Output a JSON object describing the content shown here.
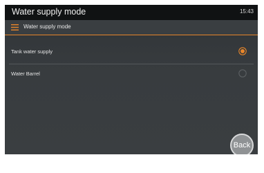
{
  "titlebar": {
    "title": "Water supply mode",
    "clock": "15:43"
  },
  "header": {
    "menu_icon": "hamburger-menu-icon",
    "label": "Water supply mode"
  },
  "options": [
    {
      "label": "Tank water supply",
      "selected": true
    },
    {
      "label": "Water Barrel",
      "selected": false
    }
  ],
  "back_button": {
    "label": "Back"
  },
  "colors": {
    "accent": "#e8862a",
    "background": "#383c3f",
    "titlebar": "#101213"
  }
}
